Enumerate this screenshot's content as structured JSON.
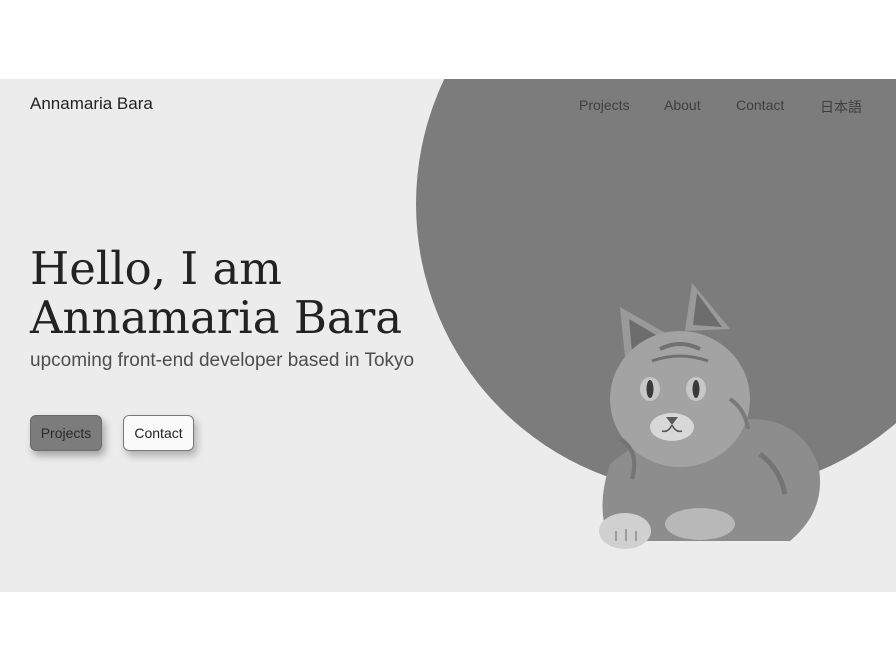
{
  "header": {
    "brand": "Annamaria Bara"
  },
  "nav": {
    "items": [
      {
        "label": "Projects"
      },
      {
        "label": "About"
      },
      {
        "label": "Contact"
      },
      {
        "label": "日本語"
      }
    ]
  },
  "hero": {
    "headline_line1": "Hello, I am",
    "headline_line2": "Annamaria Bara",
    "subtitle": "upcoming front-end developer based in Tokyo",
    "buttons": {
      "projects_label": "Projects",
      "contact_label": "Contact"
    }
  },
  "colors": {
    "hero_background": "#ececec",
    "circle": "#7c7c7c",
    "primary_button": "#7c7c7c",
    "text": "#222222"
  },
  "icons": {
    "illustration": "cat-photo"
  }
}
